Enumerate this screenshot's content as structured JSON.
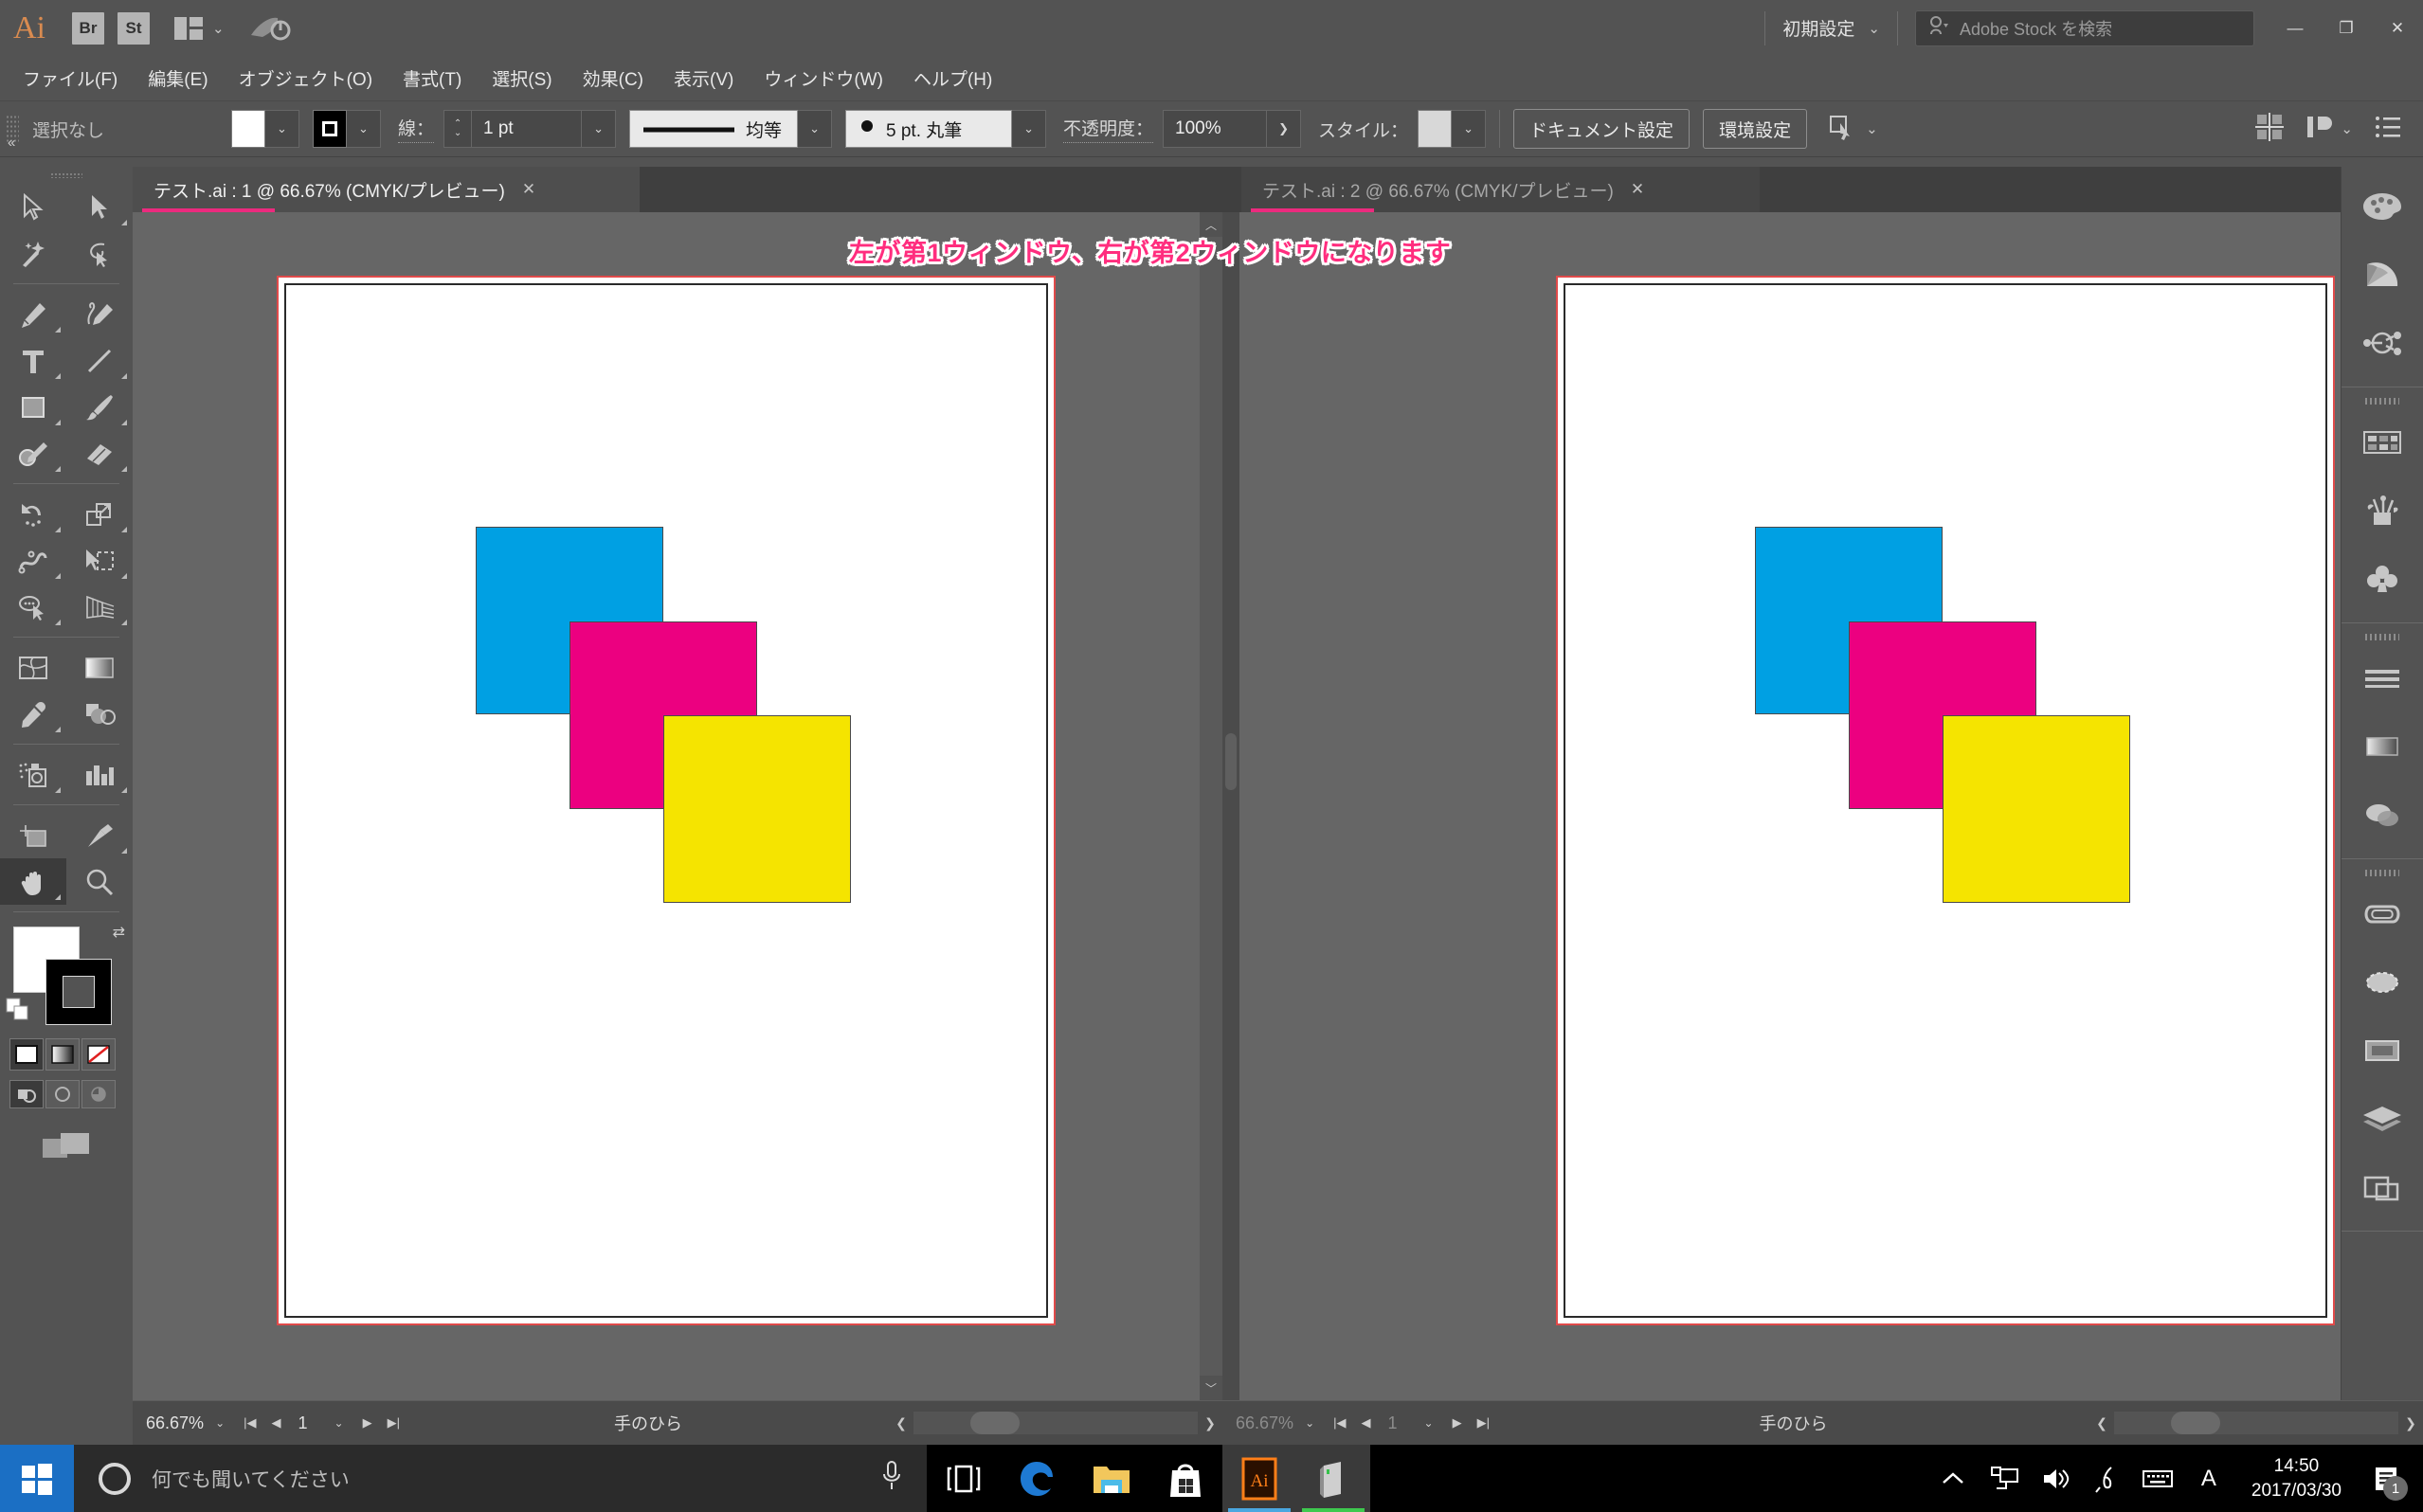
{
  "titlebar": {
    "app_logo": "Ai",
    "bridge_label": "Br",
    "stock_label": "St",
    "arrange_icon": "arrange-documents-icon",
    "arrange_chevron": "⌄",
    "rocket_icon": "rocket-launch-icon",
    "workspace_label": "初期設定",
    "workspace_chevron": "⌄",
    "search_icon": "search-person-icon",
    "search_placeholder": "Adobe Stock を検索",
    "minimize": "—",
    "maximize": "❐",
    "close": "✕"
  },
  "menubar": {
    "items": [
      {
        "label": "ファイル(F)"
      },
      {
        "label": "編集(E)"
      },
      {
        "label": "オブジェクト(O)"
      },
      {
        "label": "書式(T)"
      },
      {
        "label": "選択(S)"
      },
      {
        "label": "効果(C)"
      },
      {
        "label": "表示(V)"
      },
      {
        "label": "ウィンドウ(W)"
      },
      {
        "label": "ヘルプ(H)"
      }
    ]
  },
  "controlbar": {
    "selection_status": "選択なし",
    "fill_swatch_color": "#ffffff",
    "stroke_swatch_color": "#000000",
    "stroke_label": "線：",
    "stroke_weight": "1 pt",
    "stroke_profile": "均等",
    "brush_label": "5 pt. 丸筆",
    "opacity_label": "不透明度：",
    "opacity_value": "100%",
    "opacity_chevron": "❯",
    "style_label": "スタイル：",
    "style_swatch_color": "#d8d8d8",
    "document_setup_button": "ドキュメント設定",
    "preferences_button": "環境設定",
    "select_similar_icon": "select-similar-objects-icon",
    "align_icon": "align-icon",
    "distribute_icon": "distribute-icon",
    "panel_menu_icon": "panel-options-icon"
  },
  "toolbar": {
    "collapse_icon": "«",
    "tools": [
      {
        "name": "selection-tool",
        "icon": "arrow-outline",
        "has_flyout": false,
        "active": false
      },
      {
        "name": "direct-selection-tool",
        "icon": "arrow-solid",
        "has_flyout": true,
        "active": false
      },
      {
        "name": "magic-wand-tool",
        "icon": "magic-wand",
        "has_flyout": false,
        "active": false
      },
      {
        "name": "lasso-tool",
        "icon": "lasso",
        "has_flyout": false,
        "active": false
      },
      {
        "name": "pen-tool",
        "icon": "pen",
        "has_flyout": true,
        "active": false
      },
      {
        "name": "curvature-tool",
        "icon": "curvature",
        "has_flyout": false,
        "active": false
      },
      {
        "name": "type-tool",
        "icon": "type-T",
        "has_flyout": true,
        "active": false
      },
      {
        "name": "line-segment-tool",
        "icon": "line",
        "has_flyout": true,
        "active": false
      },
      {
        "name": "rectangle-tool",
        "icon": "rectangle",
        "has_flyout": true,
        "active": false
      },
      {
        "name": "paintbrush-tool",
        "icon": "paintbrush",
        "has_flyout": true,
        "active": false
      },
      {
        "name": "shaper-tool",
        "icon": "shaper-pencil",
        "has_flyout": true,
        "active": false
      },
      {
        "name": "eraser-tool",
        "icon": "eraser",
        "has_flyout": true,
        "active": false
      },
      {
        "name": "rotate-tool",
        "icon": "rotate",
        "has_flyout": true,
        "active": false
      },
      {
        "name": "scale-tool",
        "icon": "scale",
        "has_flyout": true,
        "active": false
      },
      {
        "name": "width-tool",
        "icon": "width-warp",
        "has_flyout": true,
        "active": false
      },
      {
        "name": "free-transform-tool",
        "icon": "free-transform",
        "has_flyout": true,
        "active": false
      },
      {
        "name": "shape-builder-tool",
        "icon": "shape-builder",
        "has_flyout": true,
        "active": false
      },
      {
        "name": "perspective-grid-tool",
        "icon": "perspective-grid",
        "has_flyout": true,
        "active": false
      },
      {
        "name": "mesh-tool",
        "icon": "mesh",
        "has_flyout": false,
        "active": false
      },
      {
        "name": "gradient-tool",
        "icon": "gradient",
        "has_flyout": false,
        "active": false
      },
      {
        "name": "eyedropper-tool",
        "icon": "eyedropper",
        "has_flyout": true,
        "active": false
      },
      {
        "name": "blend-tool",
        "icon": "blend",
        "has_flyout": false,
        "active": false
      },
      {
        "name": "symbol-sprayer-tool",
        "icon": "symbol-sprayer",
        "has_flyout": true,
        "active": false
      },
      {
        "name": "column-graph-tool",
        "icon": "bar-graph",
        "has_flyout": true,
        "active": false
      },
      {
        "name": "artboard-tool",
        "icon": "artboard",
        "has_flyout": false,
        "active": false
      },
      {
        "name": "slice-tool",
        "icon": "slice-knife",
        "has_flyout": true,
        "active": false
      },
      {
        "name": "hand-tool",
        "icon": "hand",
        "has_flyout": true,
        "active": true
      },
      {
        "name": "zoom-tool",
        "icon": "magnifier",
        "has_flyout": false,
        "active": false
      }
    ],
    "fill_color": "#ffffff",
    "stroke_color": "#000000",
    "swap_icon": "swap-fill-stroke-icon",
    "default_icon": "default-fill-stroke-icon",
    "color_mode_color": "color-swatch-icon",
    "color_mode_gradient": "gradient-swatch-icon",
    "color_mode_none": "none-swatch-icon",
    "draw_normal": "draw-normal-icon",
    "draw_behind": "draw-behind-icon",
    "draw_inside": "draw-inside-icon",
    "screen_mode": "change-screen-mode-icon"
  },
  "tabs": [
    {
      "label": "テスト.ai : 1 @ 66.67% (CMYK/プレビュー)",
      "close": "✕",
      "active": true
    },
    {
      "label": "テスト.ai : 2 @ 66.67% (CMYK/プレビュー)",
      "close": "✕",
      "active": false
    }
  ],
  "annotation": {
    "text": "左が第1ウィンドウ、右が第2ウィンドウになります",
    "color": "#ff2d7e"
  },
  "artwork": {
    "cyan_color": "#00A0E3",
    "magenta_color": "#EC0080",
    "yellow_color": "#F5E400",
    "artboard_border_color": "#e04a4a",
    "page_border_color": "#2a2a2a"
  },
  "statusbar_left": {
    "zoom": "66.67%",
    "zoom_chevron": "⌄",
    "first_page_icon": "first-page-icon",
    "prev_page_icon": "prev-page-icon",
    "page_number": "1",
    "page_chevron": "⌄",
    "next_page_icon": "next-page-icon",
    "last_page_icon": "last-page-icon",
    "tool_name": "手のひら",
    "scroll_right_icon": "❯"
  },
  "statusbar_right": {
    "zoom": "66.67%",
    "zoom_chevron": "⌄",
    "page_number": "1",
    "page_chevron": "⌄",
    "tool_name": "手のひら",
    "scroll_right_icon": "❯"
  },
  "rightdock": {
    "groups": [
      {
        "icons": [
          {
            "name": "color-panel-icon"
          },
          {
            "name": "color-guide-panel-icon"
          },
          {
            "name": "recolor-artwork-panel-icon"
          }
        ]
      },
      {
        "icons": [
          {
            "name": "swatches-panel-icon"
          },
          {
            "name": "brushes-panel-icon"
          },
          {
            "name": "symbols-panel-icon"
          }
        ]
      },
      {
        "icons": [
          {
            "name": "stroke-panel-icon"
          },
          {
            "name": "gradient-panel-icon"
          },
          {
            "name": "transparency-panel-icon"
          }
        ]
      },
      {
        "icons": [
          {
            "name": "creative-cloud-libraries-icon"
          },
          {
            "name": "appearance-panel-icon"
          },
          {
            "name": "graphic-styles-panel-icon"
          },
          {
            "name": "layers-panel-icon"
          },
          {
            "name": "artboards-panel-icon"
          }
        ]
      }
    ]
  },
  "taskbar": {
    "start_icon": "windows-start-icon",
    "cortana_placeholder": "何でも聞いてください",
    "cortana_ring_icon": "cortana-circle-icon",
    "microphone_icon": "microphone-icon",
    "task_view_icon": "task-view-icon",
    "apps": [
      {
        "name": "edge-browser",
        "label": "e",
        "color": "#1f7fd4",
        "active": false
      },
      {
        "name": "file-explorer",
        "label": "",
        "color": "#f6c95c",
        "active": false
      },
      {
        "name": "microsoft-store",
        "label": "",
        "color": "#ffffff",
        "active": false
      },
      {
        "name": "adobe-illustrator",
        "label": "Ai",
        "color": "#ff7f18",
        "active": true
      },
      {
        "name": "server-app",
        "label": "",
        "color": "#c9c9c9",
        "active": true
      }
    ],
    "tray": [
      {
        "name": "show-hidden-icons",
        "glyph": "︿"
      },
      {
        "name": "network-icon",
        "glyph": "🖧"
      },
      {
        "name": "volume-icon",
        "glyph": "🔊"
      },
      {
        "name": "pen-input-icon",
        "glyph": "✎"
      },
      {
        "name": "keyboard-icon",
        "glyph": "⌨"
      },
      {
        "name": "ime-mode-icon",
        "glyph": "A"
      }
    ],
    "time": "14:50",
    "date": "2017/03/30",
    "notification_icon": "action-center-icon",
    "notification_count": "1"
  }
}
